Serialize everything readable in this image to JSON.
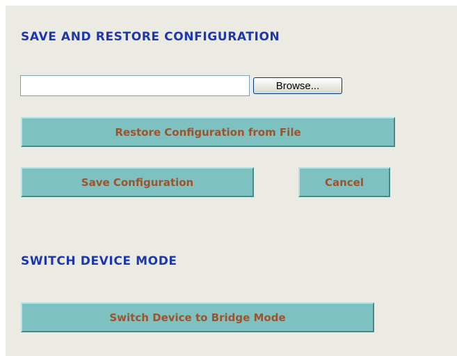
{
  "save_restore": {
    "title": "SAVE AND RESTORE CONFIGURATION",
    "file_input": {
      "value": ""
    },
    "browse_label": "Browse...",
    "restore_label": "Restore Configuration from File",
    "save_label": "Save Configuration",
    "cancel_label": "Cancel"
  },
  "switch_mode": {
    "title": "SWITCH DEVICE MODE",
    "bridge_label": "Switch Device to Bridge Mode"
  },
  "colors": {
    "panel_background": "#ecebe3",
    "title": "#1c37b0",
    "button_fill": "#7dc1c0",
    "button_text": "#a0522d"
  }
}
